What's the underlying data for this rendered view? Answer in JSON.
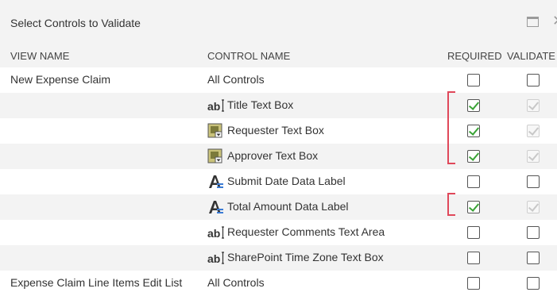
{
  "dialog": {
    "title": "Select Controls to Validate",
    "maximize_icon": "maximize-icon",
    "close_icon": "close-icon"
  },
  "columns": {
    "view_name": "VIEW NAME",
    "control_name": "CONTROL NAME",
    "required": "REQUIRED",
    "validate": "VALIDATE"
  },
  "colors": {
    "check": "#3aa336",
    "highlight_bracket": "#e0485a",
    "alt_row": "#f3f3f3"
  },
  "rows": [
    {
      "view": "New Expense Claim",
      "control": "All Controls",
      "icon": "",
      "required": false,
      "validate": false,
      "validate_disabled": false
    },
    {
      "view": "",
      "control": "Title Text Box",
      "icon": "textbox-icon",
      "required": true,
      "validate": true,
      "validate_disabled": true
    },
    {
      "view": "",
      "control": "Requester Text Box",
      "icon": "picker-icon",
      "required": true,
      "validate": true,
      "validate_disabled": true
    },
    {
      "view": "",
      "control": "Approver Text Box",
      "icon": "picker-icon",
      "required": true,
      "validate": true,
      "validate_disabled": true
    },
    {
      "view": "",
      "control": "Submit Date Data Label",
      "icon": "data-label-icon",
      "required": false,
      "validate": false,
      "validate_disabled": false
    },
    {
      "view": "",
      "control": "Total Amount Data Label",
      "icon": "data-label-icon",
      "required": true,
      "validate": true,
      "validate_disabled": true
    },
    {
      "view": "",
      "control": "Requester Comments Text Area",
      "icon": "textbox-icon",
      "required": false,
      "validate": false,
      "validate_disabled": false
    },
    {
      "view": "",
      "control": "SharePoint Time Zone Text Box",
      "icon": "textbox-icon",
      "required": false,
      "validate": false,
      "validate_disabled": false
    },
    {
      "view": "Expense Claim Line Items Edit List",
      "control": "All Controls",
      "icon": "",
      "required": false,
      "validate": false,
      "validate_disabled": false
    }
  ]
}
